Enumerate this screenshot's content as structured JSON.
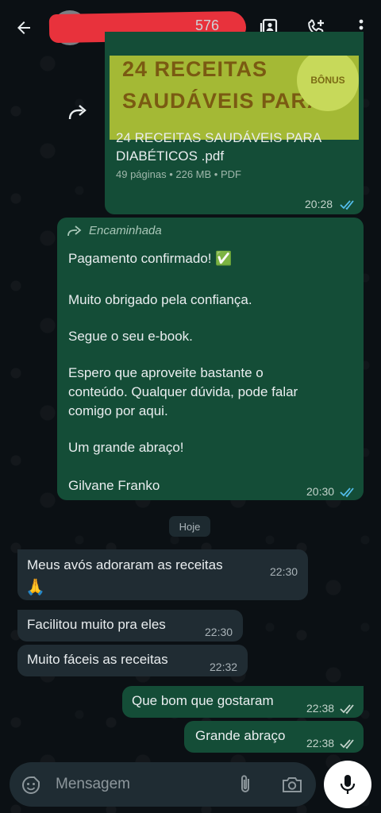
{
  "header": {
    "contact_visible_tail": "576"
  },
  "document_message": {
    "thumbnail_line1": "24 RECEITAS",
    "thumbnail_line2": "SAUDÁVEIS PARA",
    "thumbnail_badge": "BÔNUS",
    "title": "24 RECEITAS SAUDÁVEIS PARA DIABÉTICOS .pdf",
    "meta": "49 páginas • 226 MB • PDF",
    "time": "20:28"
  },
  "forwarded_message": {
    "label": "Encaminhada",
    "line1": "Pagamento confirmado! ✅",
    "line2": "Muito obrigado pela confiança.",
    "line3": "Segue o seu e-book.",
    "line4": "Espero que aproveite bastante o",
    "line5": "conteúdo. Qualquer dúvida, pode falar",
    "line6": "comigo por aqui.",
    "line7": "Um grande abraço!",
    "line8": "Gilvane Franko",
    "time": "20:30"
  },
  "date_separator": "Hoje",
  "messages": [
    {
      "text": "Meus avós adoraram as receitas",
      "emoji": "🙏",
      "time": "22:30"
    },
    {
      "text": "Facilitou muito pra eles",
      "time": "22:30"
    },
    {
      "text": "Muito fáceis as receitas",
      "time": "22:32"
    },
    {
      "text": "Que bom que gostaram",
      "time": "22:38"
    },
    {
      "text": "Grande abraço",
      "time": "22:38"
    }
  ],
  "composer": {
    "placeholder": "Mensagem"
  },
  "colors": {
    "outgoing_bubble": "#144d37",
    "incoming_bubble": "#202c33",
    "read_ticks": "#53bdeb",
    "delivered_ticks": "#c3d3cb"
  }
}
